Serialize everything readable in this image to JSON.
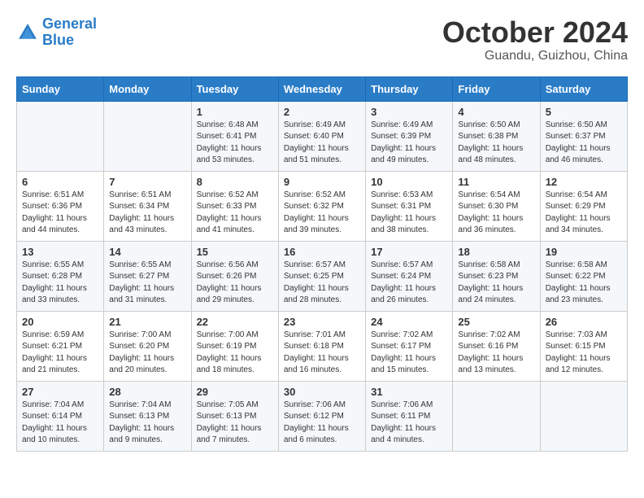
{
  "header": {
    "logo_line1": "General",
    "logo_line2": "Blue",
    "month": "October 2024",
    "location": "Guandu, Guizhou, China"
  },
  "weekdays": [
    "Sunday",
    "Monday",
    "Tuesday",
    "Wednesday",
    "Thursday",
    "Friday",
    "Saturday"
  ],
  "weeks": [
    [
      {
        "day": "",
        "info": ""
      },
      {
        "day": "",
        "info": ""
      },
      {
        "day": "1",
        "info": "Sunrise: 6:48 AM\nSunset: 6:41 PM\nDaylight: 11 hours and 53 minutes."
      },
      {
        "day": "2",
        "info": "Sunrise: 6:49 AM\nSunset: 6:40 PM\nDaylight: 11 hours and 51 minutes."
      },
      {
        "day": "3",
        "info": "Sunrise: 6:49 AM\nSunset: 6:39 PM\nDaylight: 11 hours and 49 minutes."
      },
      {
        "day": "4",
        "info": "Sunrise: 6:50 AM\nSunset: 6:38 PM\nDaylight: 11 hours and 48 minutes."
      },
      {
        "day": "5",
        "info": "Sunrise: 6:50 AM\nSunset: 6:37 PM\nDaylight: 11 hours and 46 minutes."
      }
    ],
    [
      {
        "day": "6",
        "info": "Sunrise: 6:51 AM\nSunset: 6:36 PM\nDaylight: 11 hours and 44 minutes."
      },
      {
        "day": "7",
        "info": "Sunrise: 6:51 AM\nSunset: 6:34 PM\nDaylight: 11 hours and 43 minutes."
      },
      {
        "day": "8",
        "info": "Sunrise: 6:52 AM\nSunset: 6:33 PM\nDaylight: 11 hours and 41 minutes."
      },
      {
        "day": "9",
        "info": "Sunrise: 6:52 AM\nSunset: 6:32 PM\nDaylight: 11 hours and 39 minutes."
      },
      {
        "day": "10",
        "info": "Sunrise: 6:53 AM\nSunset: 6:31 PM\nDaylight: 11 hours and 38 minutes."
      },
      {
        "day": "11",
        "info": "Sunrise: 6:54 AM\nSunset: 6:30 PM\nDaylight: 11 hours and 36 minutes."
      },
      {
        "day": "12",
        "info": "Sunrise: 6:54 AM\nSunset: 6:29 PM\nDaylight: 11 hours and 34 minutes."
      }
    ],
    [
      {
        "day": "13",
        "info": "Sunrise: 6:55 AM\nSunset: 6:28 PM\nDaylight: 11 hours and 33 minutes."
      },
      {
        "day": "14",
        "info": "Sunrise: 6:55 AM\nSunset: 6:27 PM\nDaylight: 11 hours and 31 minutes."
      },
      {
        "day": "15",
        "info": "Sunrise: 6:56 AM\nSunset: 6:26 PM\nDaylight: 11 hours and 29 minutes."
      },
      {
        "day": "16",
        "info": "Sunrise: 6:57 AM\nSunset: 6:25 PM\nDaylight: 11 hours and 28 minutes."
      },
      {
        "day": "17",
        "info": "Sunrise: 6:57 AM\nSunset: 6:24 PM\nDaylight: 11 hours and 26 minutes."
      },
      {
        "day": "18",
        "info": "Sunrise: 6:58 AM\nSunset: 6:23 PM\nDaylight: 11 hours and 24 minutes."
      },
      {
        "day": "19",
        "info": "Sunrise: 6:58 AM\nSunset: 6:22 PM\nDaylight: 11 hours and 23 minutes."
      }
    ],
    [
      {
        "day": "20",
        "info": "Sunrise: 6:59 AM\nSunset: 6:21 PM\nDaylight: 11 hours and 21 minutes."
      },
      {
        "day": "21",
        "info": "Sunrise: 7:00 AM\nSunset: 6:20 PM\nDaylight: 11 hours and 20 minutes."
      },
      {
        "day": "22",
        "info": "Sunrise: 7:00 AM\nSunset: 6:19 PM\nDaylight: 11 hours and 18 minutes."
      },
      {
        "day": "23",
        "info": "Sunrise: 7:01 AM\nSunset: 6:18 PM\nDaylight: 11 hours and 16 minutes."
      },
      {
        "day": "24",
        "info": "Sunrise: 7:02 AM\nSunset: 6:17 PM\nDaylight: 11 hours and 15 minutes."
      },
      {
        "day": "25",
        "info": "Sunrise: 7:02 AM\nSunset: 6:16 PM\nDaylight: 11 hours and 13 minutes."
      },
      {
        "day": "26",
        "info": "Sunrise: 7:03 AM\nSunset: 6:15 PM\nDaylight: 11 hours and 12 minutes."
      }
    ],
    [
      {
        "day": "27",
        "info": "Sunrise: 7:04 AM\nSunset: 6:14 PM\nDaylight: 11 hours and 10 minutes."
      },
      {
        "day": "28",
        "info": "Sunrise: 7:04 AM\nSunset: 6:13 PM\nDaylight: 11 hours and 9 minutes."
      },
      {
        "day": "29",
        "info": "Sunrise: 7:05 AM\nSunset: 6:13 PM\nDaylight: 11 hours and 7 minutes."
      },
      {
        "day": "30",
        "info": "Sunrise: 7:06 AM\nSunset: 6:12 PM\nDaylight: 11 hours and 6 minutes."
      },
      {
        "day": "31",
        "info": "Sunrise: 7:06 AM\nSunset: 6:11 PM\nDaylight: 11 hours and 4 minutes."
      },
      {
        "day": "",
        "info": ""
      },
      {
        "day": "",
        "info": ""
      }
    ]
  ]
}
